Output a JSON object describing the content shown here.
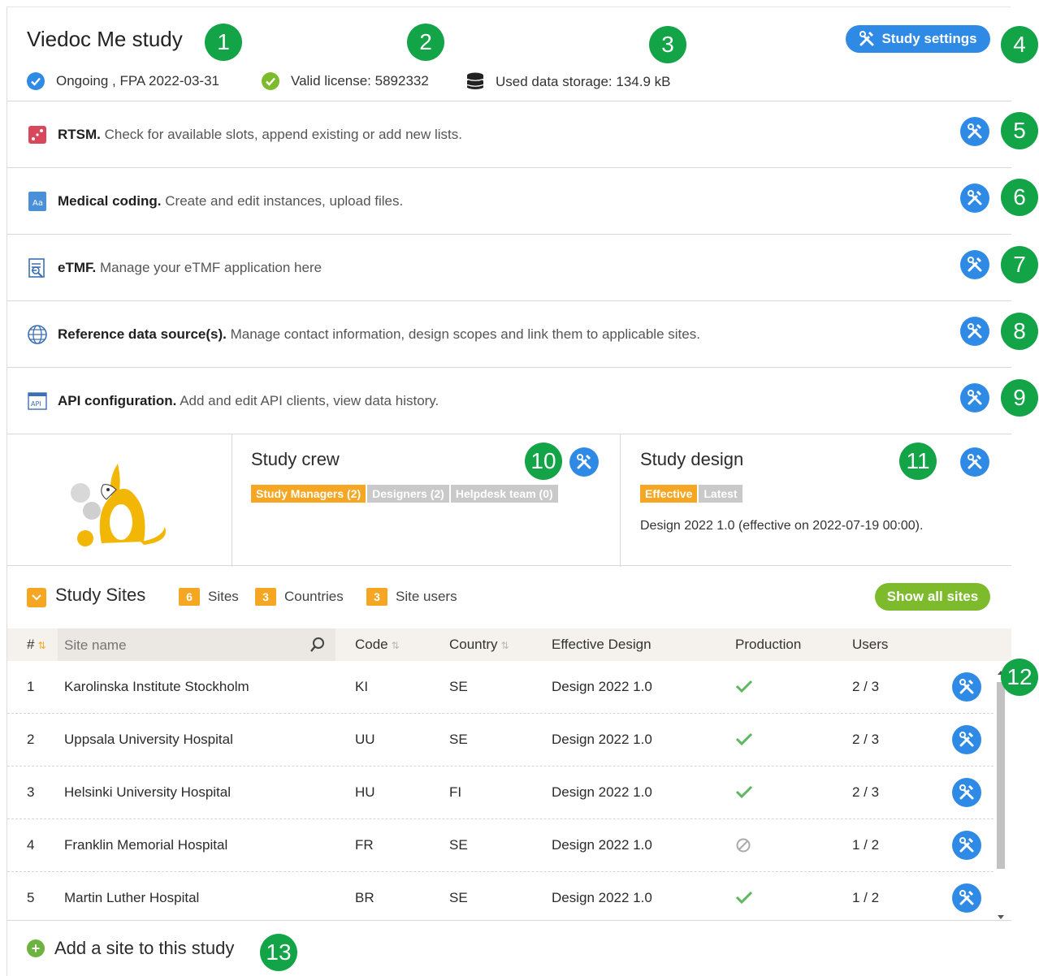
{
  "header": {
    "title": "Viedoc Me study",
    "status": "Ongoing , FPA 2022-03-31",
    "license": "Valid license: 5892332",
    "storage": "Used data storage: 134.9 kB",
    "settings_label": "Study settings"
  },
  "modules": [
    {
      "name": "RTSM.",
      "desc": "Check for available slots, append existing or add new lists.",
      "icon": "dice-icon"
    },
    {
      "name": "Medical coding.",
      "desc": "Create and edit instances, upload files.",
      "icon": "dictionary-icon"
    },
    {
      "name": "eTMF.",
      "desc": "Manage your eTMF application here",
      "icon": "etmf-icon"
    },
    {
      "name": "Reference data source(s).",
      "desc": "Manage contact information, design scopes and link them to applicable sites.",
      "icon": "globe-icon"
    },
    {
      "name": "API configuration.",
      "desc": "Add and edit API clients, view data history.",
      "icon": "api-icon"
    }
  ],
  "crew": {
    "title": "Study crew",
    "tabs": [
      "Study Managers (2)",
      "Designers (2)",
      "Helpdesk team (0)"
    ]
  },
  "design": {
    "title": "Study design",
    "tabs": [
      "Effective",
      "Latest"
    ],
    "text": "Design 2022 1.0 (effective on 2022-07-19 00:00)."
  },
  "sites": {
    "title": "Study Sites",
    "sites_count": "6",
    "sites_label": "Sites",
    "countries_count": "3",
    "countries_label": "Countries",
    "users_count": "3",
    "users_label": "Site users",
    "show_all": "Show all sites",
    "columns": {
      "num": "#",
      "name": "Site name",
      "code": "Code",
      "country": "Country",
      "design": "Effective Design",
      "production": "Production",
      "users": "Users"
    },
    "rows": [
      {
        "num": "1",
        "name": "Karolinska Institute Stockholm",
        "code": "KI",
        "country": "SE",
        "design": "Design 2022 1.0",
        "production": "check",
        "users": "2 / 3"
      },
      {
        "num": "2",
        "name": "Uppsala University Hospital",
        "code": "UU",
        "country": "SE",
        "design": "Design 2022 1.0",
        "production": "check",
        "users": "2 / 3"
      },
      {
        "num": "3",
        "name": "Helsinki University Hospital",
        "code": "HU",
        "country": "FI",
        "design": "Design 2022 1.0",
        "production": "check",
        "users": "2 / 3"
      },
      {
        "num": "4",
        "name": "Franklin Memorial Hospital",
        "code": "FR",
        "country": "SE",
        "design": "Design 2022 1.0",
        "production": "disabled",
        "users": "1 / 2"
      },
      {
        "num": "5",
        "name": "Martin Luther Hospital",
        "code": "BR",
        "country": "SE",
        "design": "Design 2022 1.0",
        "production": "check",
        "users": "1 / 2"
      }
    ],
    "add_site": "Add a site to this study"
  },
  "callouts": [
    "1",
    "2",
    "3",
    "4",
    "5",
    "6",
    "7",
    "8",
    "9",
    "10",
    "11",
    "12",
    "13"
  ],
  "colors": {
    "callout": "#12a447",
    "tool": "#2f8ae6",
    "accent": "#f5a623",
    "show_all": "#7dbb2c"
  }
}
